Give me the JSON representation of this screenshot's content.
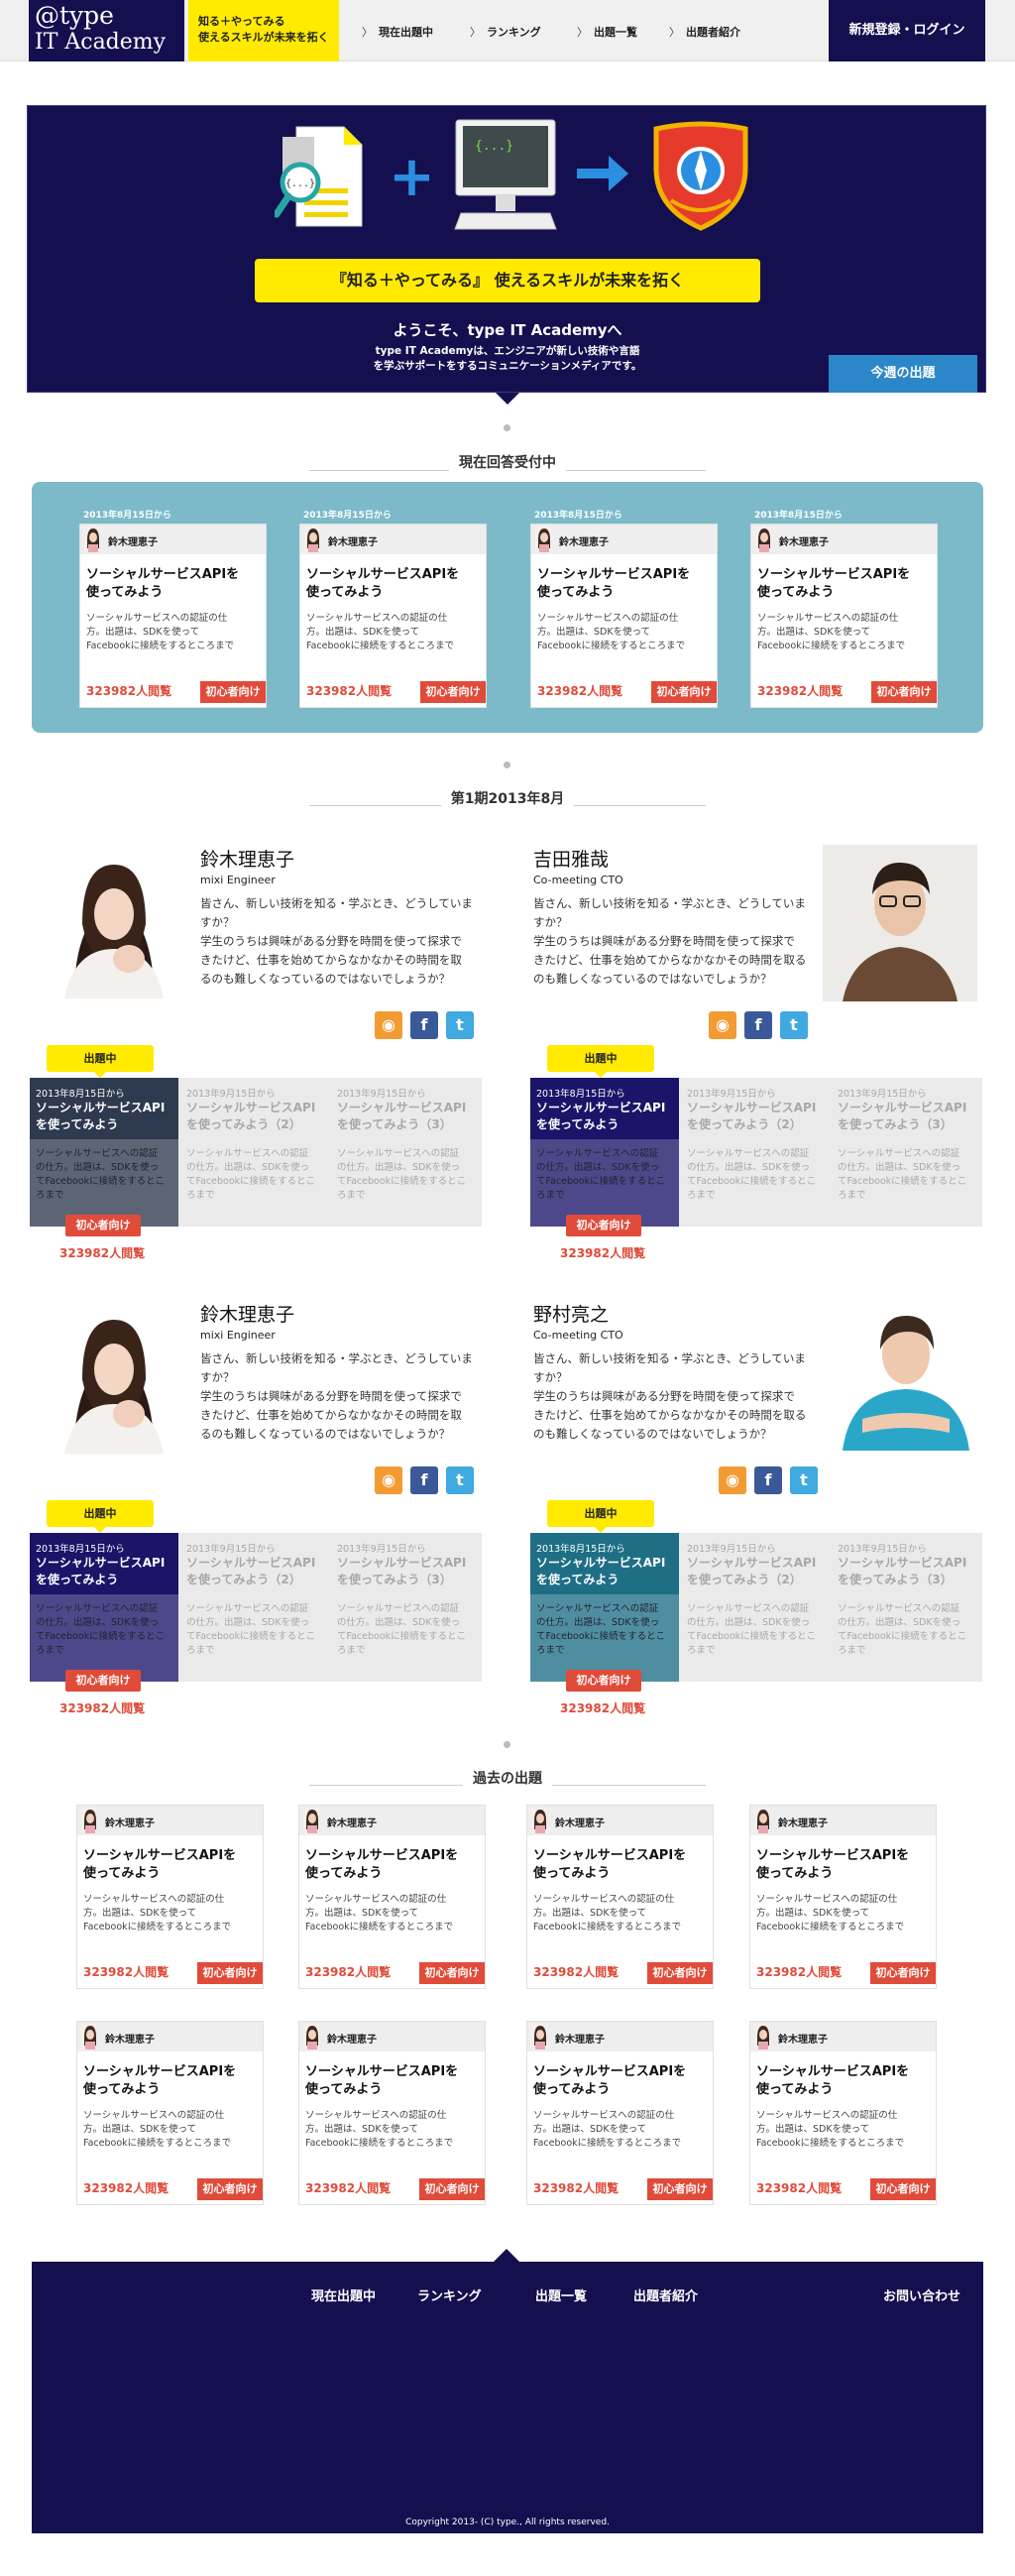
{
  "header": {
    "logo_line1": "@type",
    "logo_line2": "IT Academy",
    "tagline_line1": "知る＋やってみる",
    "tagline_line2": "使えるスキルが未来を拓く",
    "nav": [
      "現在出題中",
      "ランキング",
      "出題一覧",
      "出題者紹介"
    ],
    "login": "新規登録・ログイン"
  },
  "hero": {
    "icon_code": "{...}",
    "banner": "『知る＋やってみる』 使えるスキルが未来を拓く",
    "welcome": "ようこそ、type IT Academyへ",
    "desc_line1": "type IT Academyは、エンジニアが新しい技術や言語",
    "desc_line2": "を学ぶサポートをするコミュニケーションメディアです。",
    "week_button": "今週の出題"
  },
  "current": {
    "heading": "現在回答受付中",
    "cards": [
      {
        "date": "2013年8月15日から",
        "author": "鈴木理恵子",
        "title_line1": "ソーシャルサービスAPIを",
        "title_line2": "使ってみよう",
        "desc_line1": "ソーシャルサービスへの認証の仕",
        "desc_line2": "方。出題は、SDKを使って",
        "desc_line3": "Facebookに接続をするところまで",
        "views": "323982人閲覧",
        "badge": "初心者向け"
      },
      {
        "date": "2013年8月15日から",
        "author": "鈴木理恵子",
        "title_line1": "ソーシャルサービスAPIを",
        "title_line2": "使ってみよう",
        "desc_line1": "ソーシャルサービスへの認証の仕",
        "desc_line2": "方。出題は、SDKを使って",
        "desc_line3": "Facebookに接続をするところまで",
        "views": "323982人閲覧",
        "badge": "初心者向け"
      },
      {
        "date": "2013年8月15日から",
        "author": "鈴木理恵子",
        "title_line1": "ソーシャルサービスAPIを",
        "title_line2": "使ってみよう",
        "desc_line1": "ソーシャルサービスへの認証の仕",
        "desc_line2": "方。出題は、SDKを使って",
        "desc_line3": "Facebookに接続をするところまで",
        "views": "323982人閲覧",
        "badge": "初心者向け"
      },
      {
        "date": "2013年8月15日から",
        "author": "鈴木理恵子",
        "title_line1": "ソーシャルサービスAPIを",
        "title_line2": "使ってみよう",
        "desc_line1": "ソーシャルサービスへの認証の仕",
        "desc_line2": "方。出題は、SDKを使って",
        "desc_line3": "Facebookに接続をするところまで",
        "views": "323982人閲覧",
        "badge": "初心者向け"
      }
    ]
  },
  "period": {
    "heading": "第1期2013年8月",
    "live_tag": "出題中",
    "profiles": [
      {
        "name": "鈴木理恵子",
        "role": "mixi Engineer",
        "bio_line1": "皆さん、新しい技術を知る・学ぶとき、どうしていま",
        "bio_line2": "すか？",
        "bio_line3": "学生のうちは興味がある分野を時間を使って探求で",
        "bio_line4": "きたけど、仕事を始めてからなかなかその時間を取",
        "bio_line5": "るのも難しくなっているのではないでしょうか？",
        "accent": "#2d3a4f",
        "questions": [
          {
            "date": "2013年8月15日から",
            "title_line1": "ソーシャルサービスAPI",
            "title_line2": "を使ってみよう",
            "desc_line1": "ソーシャルサービスへの認証",
            "desc_line2": "の仕方。出題は、SDKを使っ",
            "desc_line3": "てFacebookに接続をするとこ",
            "desc_line4": "ろまで"
          },
          {
            "date": "2013年9月15日から",
            "title_line1": "ソーシャルサービスAPI",
            "title_line2": "を使ってみよう（2）",
            "desc_line1": "ソーシャルサービスへの認証",
            "desc_line2": "の仕方。出題は、SDKを使っ",
            "desc_line3": "てFacebookに接続をするとこ",
            "desc_line4": "ろまで"
          },
          {
            "date": "2013年9月15日から",
            "title_line1": "ソーシャルサービスAPI",
            "title_line2": "を使ってみよう（3）",
            "desc_line1": "ソーシャルサービスへの認証",
            "desc_line2": "の仕方。出題は、SDKを使っ",
            "desc_line3": "てFacebookに接続をするとこ",
            "desc_line4": "ろまで"
          }
        ],
        "badge": "初心者向け",
        "views": "323982人閲覧"
      },
      {
        "name": "吉田雅哉",
        "role": "Co-meeting CTO",
        "bio_line1": "皆さん、新しい技術を知る・学ぶとき、どうしていま",
        "bio_line2": "すか？",
        "bio_line3": "学生のうちは興味がある分野を時間を使って探求で",
        "bio_line4": "きたけど、仕事を始めてからなかなかその時間を取る",
        "bio_line5": "のも難しくなっているのではないでしょうか？",
        "accent": "#1a1568",
        "questions": [
          {
            "date": "2013年8月15日から",
            "title_line1": "ソーシャルサービスAPI",
            "title_line2": "を使ってみよう",
            "desc_line1": "ソーシャルサービスへの認証",
            "desc_line2": "の仕方。出題は、SDKを使っ",
            "desc_line3": "てFacebookに接続をするとこ",
            "desc_line4": "ろまで"
          },
          {
            "date": "2013年9月15日から",
            "title_line1": "ソーシャルサービスAPI",
            "title_line2": "を使ってみよう（2）",
            "desc_line1": "ソーシャルサービスへの認証",
            "desc_line2": "の仕方。出題は、SDKを使っ",
            "desc_line3": "てFacebookに接続をするとこ",
            "desc_line4": "ろまで"
          },
          {
            "date": "2013年9月15日から",
            "title_line1": "ソーシャルサービスAPI",
            "title_line2": "を使ってみよう（3）",
            "desc_line1": "ソーシャルサービスへの認証",
            "desc_line2": "の仕方。出題は、SDKを使っ",
            "desc_line3": "てFacebookに接続をするとこ",
            "desc_line4": "ろまで"
          }
        ],
        "badge": "初心者向け",
        "views": "323982人閲覧"
      },
      {
        "name": "鈴木理恵子",
        "role": "mixi Engineer",
        "bio_line1": "皆さん、新しい技術を知る・学ぶとき、どうしていま",
        "bio_line2": "すか？",
        "bio_line3": "学生のうちは興味がある分野を時間を使って探求で",
        "bio_line4": "きたけど、仕事を始めてからなかなかその時間を取",
        "bio_line5": "るのも難しくなっているのではないでしょうか？",
        "accent": "#1a1568",
        "questions": [
          {
            "date": "2013年8月15日から",
            "title_line1": "ソーシャルサービスAPI",
            "title_line2": "を使ってみよう",
            "desc_line1": "ソーシャルサービスへの認証",
            "desc_line2": "の仕方。出題は、SDKを使っ",
            "desc_line3": "てFacebookに接続をするとこ",
            "desc_line4": "ろまで"
          },
          {
            "date": "2013年9月15日から",
            "title_line1": "ソーシャルサービスAPI",
            "title_line2": "を使ってみよう（2）",
            "desc_line1": "ソーシャルサービスへの認証",
            "desc_line2": "の仕方。出題は、SDKを使っ",
            "desc_line3": "てFacebookに接続をするとこ",
            "desc_line4": "ろまで"
          },
          {
            "date": "2013年9月15日から",
            "title_line1": "ソーシャルサービスAPI",
            "title_line2": "を使ってみよう（3）",
            "desc_line1": "ソーシャルサービスへの認証",
            "desc_line2": "の仕方。出題は、SDKを使っ",
            "desc_line3": "てFacebookに接続をするとこ",
            "desc_line4": "ろまで"
          }
        ],
        "badge": "初心者向け",
        "views": "323982人閲覧"
      },
      {
        "name": "野村亮之",
        "role": "Co-meeting CTO",
        "bio_line1": "皆さん、新しい技術を知る・学ぶとき、どうしていま",
        "bio_line2": "すか？",
        "bio_line3": "学生のうちは興味がある分野を時間を使って探求で",
        "bio_line4": "きたけど、仕事を始めてからなかなかその時間を取る",
        "bio_line5": "のも難しくなっているのではないでしょうか？",
        "accent": "#1e6f86",
        "questions": [
          {
            "date": "2013年8月15日から",
            "title_line1": "ソーシャルサービスAPI",
            "title_line2": "を使ってみよう",
            "desc_line1": "ソーシャルサービスへの認証",
            "desc_line2": "の仕方。出題は、SDKを使っ",
            "desc_line3": "てFacebookに接続をするとこ",
            "desc_line4": "ろまで"
          },
          {
            "date": "2013年9月15日から",
            "title_line1": "ソーシャルサービスAPI",
            "title_line2": "を使ってみよう（2）",
            "desc_line1": "ソーシャルサービスへの認証",
            "desc_line2": "の仕方。出題は、SDKを使っ",
            "desc_line3": "てFacebookに接続をするとこ",
            "desc_line4": "ろまで"
          },
          {
            "date": "2013年9月15日から",
            "title_line1": "ソーシャルサービスAPI",
            "title_line2": "を使ってみよう（3）",
            "desc_line1": "ソーシャルサービスへの認証",
            "desc_line2": "の仕方。出題は、SDKを使っ",
            "desc_line3": "てFacebookに接続をするとこ",
            "desc_line4": "ろまで"
          }
        ],
        "badge": "初心者向け",
        "views": "323982人閲覧"
      }
    ]
  },
  "past": {
    "heading": "過去の出題",
    "card": {
      "author": "鈴木理恵子",
      "title_line1": "ソーシャルサービスAPIを",
      "title_line2": "使ってみよう",
      "desc_line1": "ソーシャルサービスへの認証の仕",
      "desc_line2": "方。出題は、SDKを使って",
      "desc_line3": "Facebookに接続をするところまで",
      "views": "323982人閲覧",
      "badge": "初心者向け"
    }
  },
  "footer": {
    "links": [
      "現在出題中",
      "ランキング",
      "出題一覧",
      "出題者紹介"
    ],
    "contact": "お問い合わせ",
    "copyright": "Copyright 2013- (C) type., All rights reserved."
  },
  "colors": {
    "navy": "#140f4f",
    "yellow": "#ffea00",
    "teal_panel": "#7cbac9",
    "badge_red": "#e04b3a",
    "button_blue": "#2b87c8"
  }
}
